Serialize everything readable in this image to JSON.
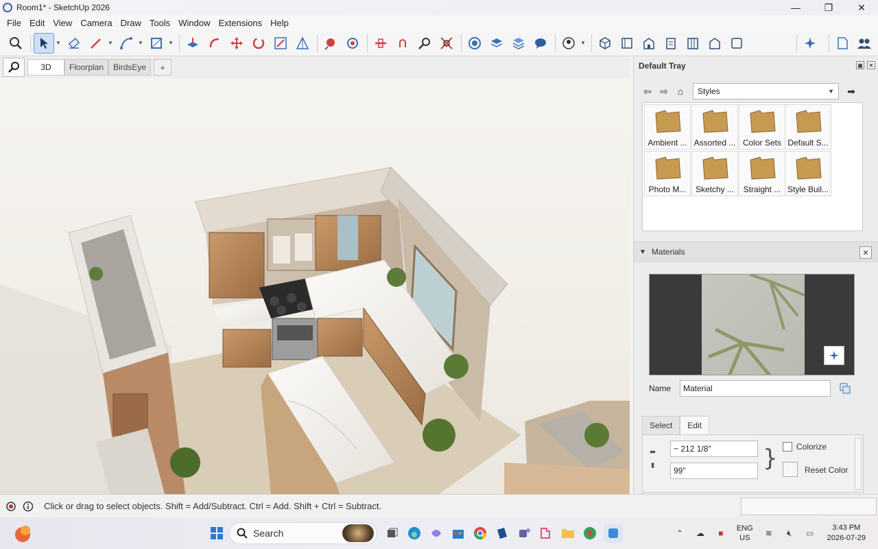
{
  "window": {
    "title": "Room1* - SketchUp 2026",
    "minimize_glyph": "—",
    "maximize_glyph": "❐",
    "close_glyph": "✕"
  },
  "menu": [
    "File",
    "Edit",
    "View",
    "Camera",
    "Draw",
    "Tools",
    "Window",
    "Extensions",
    "Help"
  ],
  "toolbar": {
    "tools": [
      "zoom-icon",
      "select-arrow-icon",
      "eraser-icon",
      "pencil-icon",
      "arc-icon",
      "rectangle-icon",
      "push-pull-icon",
      "follow-me-icon",
      "move-icon",
      "rotate-icon",
      "scale-icon",
      "offset-icon",
      "tape-measure-icon",
      "paint-bucket-icon",
      "section-plane-icon",
      "orbit-icon",
      "zoom-window-icon",
      "zoom-extents-icon",
      "components-icon",
      "layers-icon",
      "styles-icon",
      "chat-icon",
      "account-icon",
      "iso-view-icon",
      "top-view-icon",
      "front-view-icon",
      "right-view-icon",
      "back-view-icon",
      "left-view-icon",
      "bottom-view-icon",
      "ai-sparkle-icon",
      "page-icon",
      "users-icon"
    ]
  },
  "scene_tabs": {
    "tabs": [
      "3D",
      "Floorplan",
      "BirdsEye"
    ],
    "active_index": 0,
    "add_label": "+"
  },
  "tray": {
    "title": "Default Tray",
    "styles": {
      "dropdown_value": "Styles",
      "folders": [
        "Ambient ...",
        "Assorted ...",
        "Color Sets",
        "Default S...",
        "Photo M...",
        "Sketchy ...",
        "Straight ...",
        "Style Buil..."
      ]
    },
    "materials": {
      "title": "Materials",
      "name_label": "Name",
      "name_value": "Material",
      "tabs": [
        "Select",
        "Edit"
      ],
      "active_tab": "Edit",
      "width_value": "~ 212 1/8\"",
      "height_value": "99\"",
      "colorize_label": "Colorize",
      "reset_color_label": "Reset Color"
    }
  },
  "status": {
    "text": "Click or drag to select objects. Shift = Add/Subtract. Ctrl = Add. Shift + Ctrl = Subtract."
  },
  "taskbar": {
    "search_label": "Search",
    "lang_line1": "ENG",
    "lang_line2": "US",
    "time": "3:43 PM",
    "date": "2026-07-29"
  },
  "colors": {
    "accent": "#3b6fb6",
    "wood": "#b9875a",
    "marble": "#f2f0ec",
    "folder": "#c79a52"
  }
}
